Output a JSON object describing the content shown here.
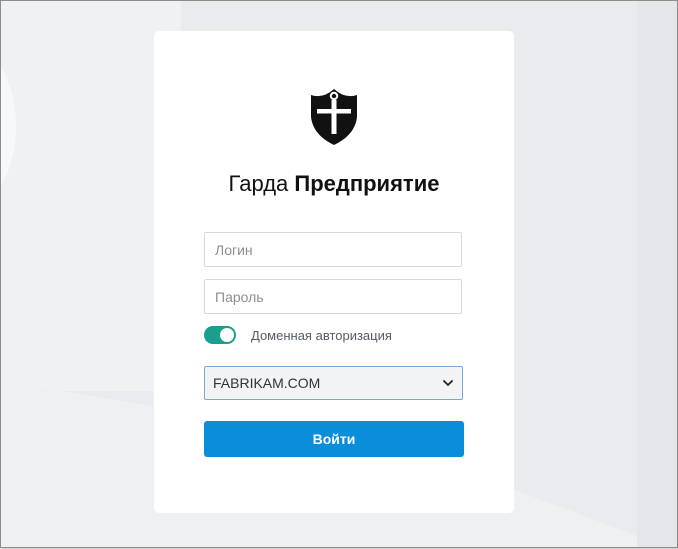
{
  "app": {
    "title_regular": "Гарда ",
    "title_bold": "Предприятие"
  },
  "form": {
    "login_placeholder": "Логин",
    "login_value": "",
    "password_placeholder": "Пароль",
    "password_value": "",
    "domain_auth": {
      "label": "Доменная авторизация",
      "enabled": true,
      "color": "#1a9e8e"
    },
    "domain_select": {
      "selected": "FABRIKAM.COM",
      "icon": "chevron-down-icon"
    },
    "submit_label": "Войти",
    "submit_color": "#0a8ed9"
  },
  "icons": {
    "logo": "shield-anchor-icon"
  }
}
